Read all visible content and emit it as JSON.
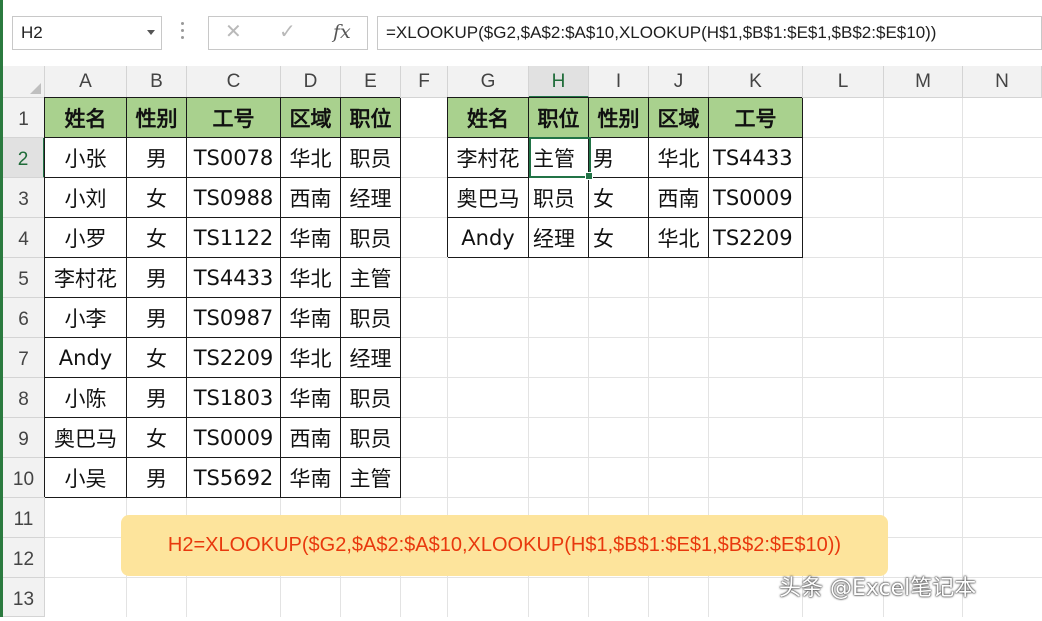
{
  "name_box": "H2",
  "formula": "=XLOOKUP($G2,$A$2:$A$10,XLOOKUP(H$1,$B$1:$E$1,$B$2:$E$10))",
  "columns": [
    "A",
    "B",
    "C",
    "D",
    "E",
    "F",
    "G",
    "H",
    "I",
    "J",
    "K",
    "L",
    "M",
    "N"
  ],
  "rows": [
    "1",
    "2",
    "3",
    "4",
    "5",
    "6",
    "7",
    "8",
    "9",
    "10",
    "11",
    "12",
    "13"
  ],
  "selected_column": "H",
  "selected_row": "2",
  "source_table": {
    "headers": [
      "姓名",
      "性别",
      "工号",
      "区域",
      "职位"
    ],
    "rows": [
      [
        "小张",
        "男",
        "TS0078",
        "华北",
        "职员"
      ],
      [
        "小刘",
        "女",
        "TS0988",
        "西南",
        "经理"
      ],
      [
        "小罗",
        "女",
        "TS1122",
        "华南",
        "职员"
      ],
      [
        "李村花",
        "男",
        "TS4433",
        "华北",
        "主管"
      ],
      [
        "小李",
        "男",
        "TS0987",
        "华南",
        "职员"
      ],
      [
        "Andy",
        "女",
        "TS2209",
        "华北",
        "经理"
      ],
      [
        "小陈",
        "男",
        "TS1803",
        "华南",
        "职员"
      ],
      [
        "奥巴马",
        "女",
        "TS0009",
        "西南",
        "职员"
      ],
      [
        "小吴",
        "男",
        "TS5692",
        "华南",
        "主管"
      ]
    ]
  },
  "lookup_table": {
    "headers": [
      "姓名",
      "职位",
      "性别",
      "区域",
      "工号"
    ],
    "rows": [
      [
        "李村花",
        "主管",
        "男",
        "华北",
        "TS4433"
      ],
      [
        "奥巴马",
        "职员",
        "女",
        "西南",
        "TS0009"
      ],
      [
        "Andy",
        "经理",
        "女",
        "华北",
        "TS2209"
      ]
    ]
  },
  "note": "H2=XLOOKUP($G2,$A$2:$A$10,XLOOKUP(H$1,$B$1:$E$1,$B$2:$E$10))",
  "watermark": "头条 @Excel笔记本",
  "colors": {
    "header_fill": "#a9d18e",
    "selection": "#217346",
    "note_bg": "#fde49c",
    "note_text": "#e8380d"
  }
}
